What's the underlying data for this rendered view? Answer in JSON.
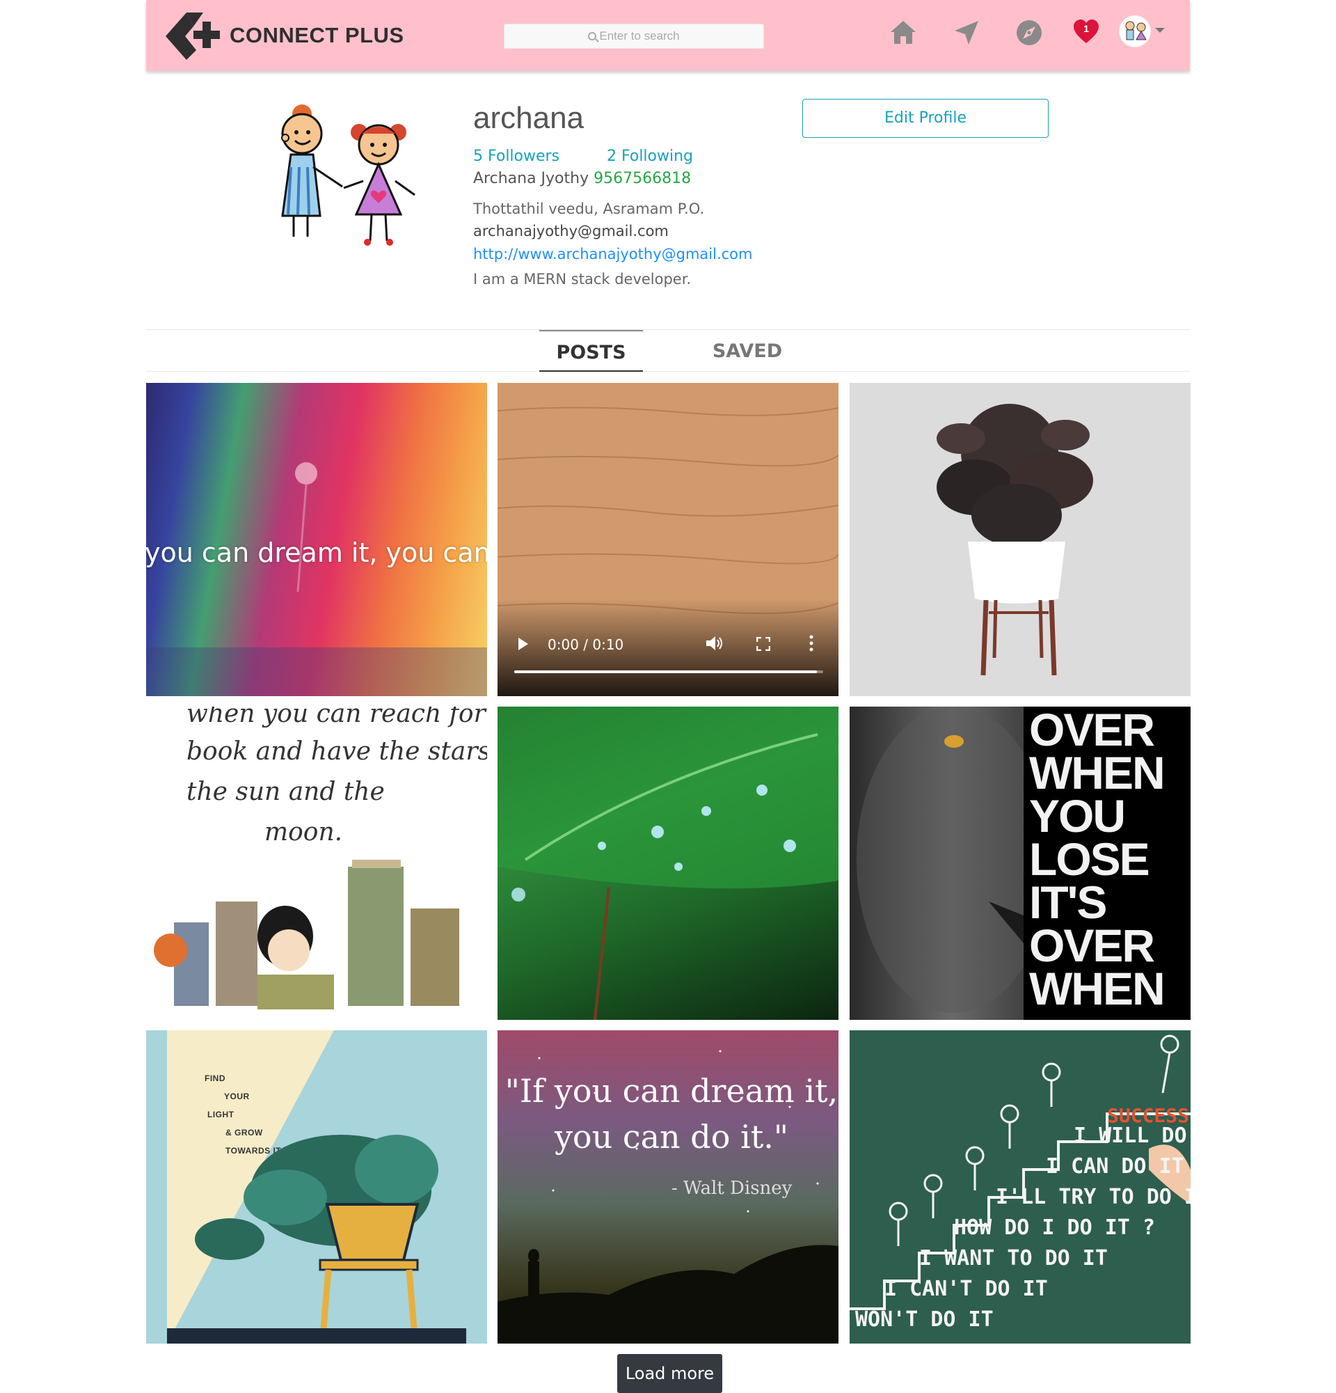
{
  "header": {
    "brand": "CONNECT PLUS",
    "search_placeholder": "Enter to search",
    "notification_count": "1",
    "bg_color": "#ffc0cb",
    "icons": [
      "home-icon",
      "send-icon",
      "explore-icon",
      "heart-icon",
      "avatar",
      "chevron-down-icon"
    ]
  },
  "profile": {
    "username": "archana",
    "edit_label": "Edit Profile",
    "followers": "5 Followers",
    "following": "2 Following",
    "fullname": "Archana Jyothy",
    "phone": "9567566818",
    "address": "Thottathil veedu, Asramam P.O.",
    "email": "archanajyothy@gmail.com",
    "website": "http://www.archanajyothy@gmail.com",
    "bio": "I am a MERN stack developer."
  },
  "tabs": {
    "posts": "POSTS",
    "saved": "SAVED"
  },
  "posts": {
    "p1_text": "you can dream it, you can do",
    "p2_time": "0:00 / 0:10",
    "p4_lines": [
      "when you can reach for a",
      "book and have the stars,",
      "the sun and the",
      "moon."
    ],
    "p6_words": [
      "OVER",
      "WHEN",
      "YOU",
      "LOSE",
      "IT'S",
      "OVER",
      "WHEN"
    ],
    "p7_lines": [
      "FIND",
      "YOUR",
      "LIGHT",
      "& GROW",
      "TOWARDS IT..."
    ],
    "p8_quote_1": "\"If you can dream it,",
    "p8_quote_2": "you can do it.\"",
    "p8_author": "- Walt Disney",
    "p9_success": "SUCCESS",
    "p9_lines": [
      "I WILL DO",
      "I CAN DO IT",
      "I'LL TRY TO DO IT",
      "HOW DO I DO IT ?",
      "I WANT TO DO IT",
      "I CAN'T DO IT",
      "WON'T DO IT"
    ]
  },
  "load_more": "Load more"
}
